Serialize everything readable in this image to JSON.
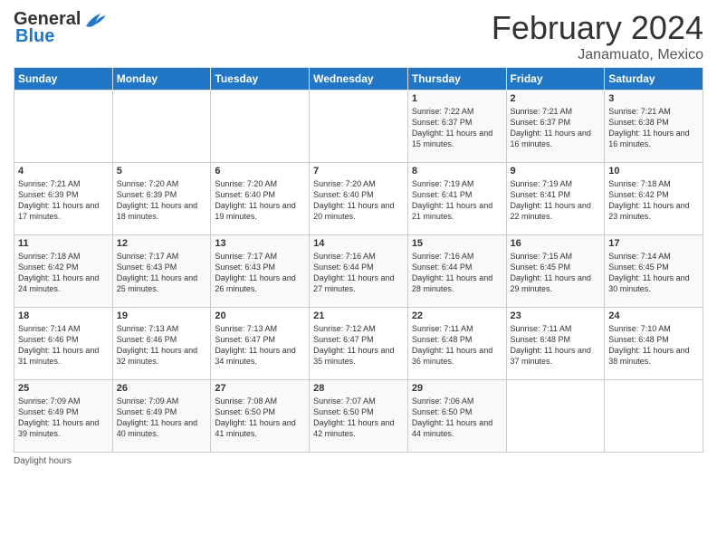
{
  "header": {
    "logo_general": "General",
    "logo_blue": "Blue",
    "month_title": "February 2024",
    "location": "Janamuato, Mexico"
  },
  "days_of_week": [
    "Sunday",
    "Monday",
    "Tuesday",
    "Wednesday",
    "Thursday",
    "Friday",
    "Saturday"
  ],
  "weeks": [
    [
      {
        "day": "",
        "sunrise": "",
        "sunset": "",
        "daylight": ""
      },
      {
        "day": "",
        "sunrise": "",
        "sunset": "",
        "daylight": ""
      },
      {
        "day": "",
        "sunrise": "",
        "sunset": "",
        "daylight": ""
      },
      {
        "day": "",
        "sunrise": "",
        "sunset": "",
        "daylight": ""
      },
      {
        "day": "1",
        "sunrise": "Sunrise: 7:22 AM",
        "sunset": "Sunset: 6:37 PM",
        "daylight": "Daylight: 11 hours and 15 minutes."
      },
      {
        "day": "2",
        "sunrise": "Sunrise: 7:21 AM",
        "sunset": "Sunset: 6:37 PM",
        "daylight": "Daylight: 11 hours and 16 minutes."
      },
      {
        "day": "3",
        "sunrise": "Sunrise: 7:21 AM",
        "sunset": "Sunset: 6:38 PM",
        "daylight": "Daylight: 11 hours and 16 minutes."
      }
    ],
    [
      {
        "day": "4",
        "sunrise": "Sunrise: 7:21 AM",
        "sunset": "Sunset: 6:39 PM",
        "daylight": "Daylight: 11 hours and 17 minutes."
      },
      {
        "day": "5",
        "sunrise": "Sunrise: 7:20 AM",
        "sunset": "Sunset: 6:39 PM",
        "daylight": "Daylight: 11 hours and 18 minutes."
      },
      {
        "day": "6",
        "sunrise": "Sunrise: 7:20 AM",
        "sunset": "Sunset: 6:40 PM",
        "daylight": "Daylight: 11 hours and 19 minutes."
      },
      {
        "day": "7",
        "sunrise": "Sunrise: 7:20 AM",
        "sunset": "Sunset: 6:40 PM",
        "daylight": "Daylight: 11 hours and 20 minutes."
      },
      {
        "day": "8",
        "sunrise": "Sunrise: 7:19 AM",
        "sunset": "Sunset: 6:41 PM",
        "daylight": "Daylight: 11 hours and 21 minutes."
      },
      {
        "day": "9",
        "sunrise": "Sunrise: 7:19 AM",
        "sunset": "Sunset: 6:41 PM",
        "daylight": "Daylight: 11 hours and 22 minutes."
      },
      {
        "day": "10",
        "sunrise": "Sunrise: 7:18 AM",
        "sunset": "Sunset: 6:42 PM",
        "daylight": "Daylight: 11 hours and 23 minutes."
      }
    ],
    [
      {
        "day": "11",
        "sunrise": "Sunrise: 7:18 AM",
        "sunset": "Sunset: 6:42 PM",
        "daylight": "Daylight: 11 hours and 24 minutes."
      },
      {
        "day": "12",
        "sunrise": "Sunrise: 7:17 AM",
        "sunset": "Sunset: 6:43 PM",
        "daylight": "Daylight: 11 hours and 25 minutes."
      },
      {
        "day": "13",
        "sunrise": "Sunrise: 7:17 AM",
        "sunset": "Sunset: 6:43 PM",
        "daylight": "Daylight: 11 hours and 26 minutes."
      },
      {
        "day": "14",
        "sunrise": "Sunrise: 7:16 AM",
        "sunset": "Sunset: 6:44 PM",
        "daylight": "Daylight: 11 hours and 27 minutes."
      },
      {
        "day": "15",
        "sunrise": "Sunrise: 7:16 AM",
        "sunset": "Sunset: 6:44 PM",
        "daylight": "Daylight: 11 hours and 28 minutes."
      },
      {
        "day": "16",
        "sunrise": "Sunrise: 7:15 AM",
        "sunset": "Sunset: 6:45 PM",
        "daylight": "Daylight: 11 hours and 29 minutes."
      },
      {
        "day": "17",
        "sunrise": "Sunrise: 7:14 AM",
        "sunset": "Sunset: 6:45 PM",
        "daylight": "Daylight: 11 hours and 30 minutes."
      }
    ],
    [
      {
        "day": "18",
        "sunrise": "Sunrise: 7:14 AM",
        "sunset": "Sunset: 6:46 PM",
        "daylight": "Daylight: 11 hours and 31 minutes."
      },
      {
        "day": "19",
        "sunrise": "Sunrise: 7:13 AM",
        "sunset": "Sunset: 6:46 PM",
        "daylight": "Daylight: 11 hours and 32 minutes."
      },
      {
        "day": "20",
        "sunrise": "Sunrise: 7:13 AM",
        "sunset": "Sunset: 6:47 PM",
        "daylight": "Daylight: 11 hours and 34 minutes."
      },
      {
        "day": "21",
        "sunrise": "Sunrise: 7:12 AM",
        "sunset": "Sunset: 6:47 PM",
        "daylight": "Daylight: 11 hours and 35 minutes."
      },
      {
        "day": "22",
        "sunrise": "Sunrise: 7:11 AM",
        "sunset": "Sunset: 6:48 PM",
        "daylight": "Daylight: 11 hours and 36 minutes."
      },
      {
        "day": "23",
        "sunrise": "Sunrise: 7:11 AM",
        "sunset": "Sunset: 6:48 PM",
        "daylight": "Daylight: 11 hours and 37 minutes."
      },
      {
        "day": "24",
        "sunrise": "Sunrise: 7:10 AM",
        "sunset": "Sunset: 6:48 PM",
        "daylight": "Daylight: 11 hours and 38 minutes."
      }
    ],
    [
      {
        "day": "25",
        "sunrise": "Sunrise: 7:09 AM",
        "sunset": "Sunset: 6:49 PM",
        "daylight": "Daylight: 11 hours and 39 minutes."
      },
      {
        "day": "26",
        "sunrise": "Sunrise: 7:09 AM",
        "sunset": "Sunset: 6:49 PM",
        "daylight": "Daylight: 11 hours and 40 minutes."
      },
      {
        "day": "27",
        "sunrise": "Sunrise: 7:08 AM",
        "sunset": "Sunset: 6:50 PM",
        "daylight": "Daylight: 11 hours and 41 minutes."
      },
      {
        "day": "28",
        "sunrise": "Sunrise: 7:07 AM",
        "sunset": "Sunset: 6:50 PM",
        "daylight": "Daylight: 11 hours and 42 minutes."
      },
      {
        "day": "29",
        "sunrise": "Sunrise: 7:06 AM",
        "sunset": "Sunset: 6:50 PM",
        "daylight": "Daylight: 11 hours and 44 minutes."
      },
      {
        "day": "",
        "sunrise": "",
        "sunset": "",
        "daylight": ""
      },
      {
        "day": "",
        "sunrise": "",
        "sunset": "",
        "daylight": ""
      }
    ]
  ],
  "footer": {
    "daylight_label": "Daylight hours"
  }
}
